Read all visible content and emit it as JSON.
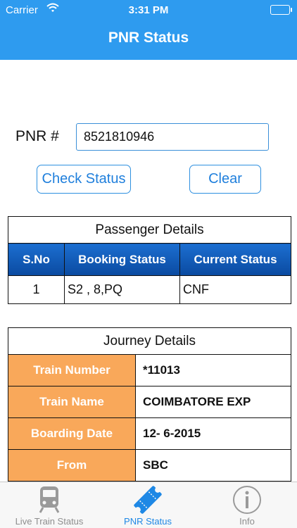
{
  "status_bar": {
    "carrier": "Carrier",
    "time": "3:31 PM"
  },
  "nav": {
    "title": "PNR Status"
  },
  "form": {
    "pnr_label": "PNR #",
    "pnr_value": "8521810946",
    "check_label": "Check Status",
    "clear_label": "Clear"
  },
  "passenger": {
    "title": "Passenger Details",
    "headers": [
      "S.No",
      "Booking Status",
      "Current Status"
    ],
    "rows": [
      {
        "sno": "1",
        "booking": "S2 , 8,PQ",
        "current": "CNF"
      }
    ]
  },
  "journey": {
    "title": "Journey Details",
    "rows": [
      {
        "label": "Train Number",
        "value": "*11013"
      },
      {
        "label": "Train Name",
        "value": "COIMBATORE EXP"
      },
      {
        "label": "Boarding Date",
        "value": "12- 6-2015"
      },
      {
        "label": "From",
        "value": "SBC"
      }
    ]
  },
  "tabs": [
    {
      "label": "Live Train Status",
      "icon": "train-icon",
      "active": false
    },
    {
      "label": "PNR Status",
      "icon": "ticket-icon",
      "active": true
    },
    {
      "label": "Info",
      "icon": "info-icon",
      "active": false
    }
  ],
  "colors": {
    "header": "#2e9bef",
    "table_header": "#0a4aa0",
    "journey_key": "#f9a85a",
    "active_tab": "#1e88e5"
  }
}
